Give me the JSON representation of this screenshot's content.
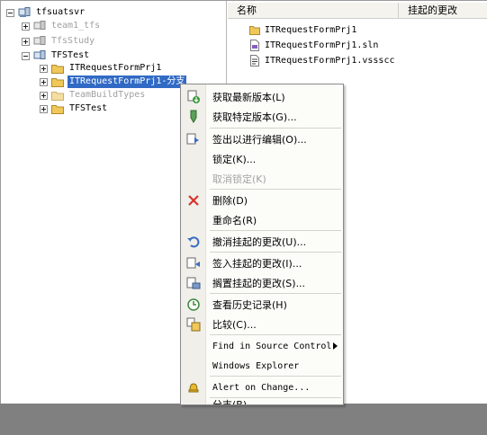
{
  "tree": {
    "items": [
      {
        "label": "tfsuatsvr"
      },
      {
        "label": "team1_tfs"
      },
      {
        "label": "TfsStudy"
      },
      {
        "label": "TFSTest"
      },
      {
        "label": "ITRequestFormPrj1"
      },
      {
        "label": "ITRequestFormPrj1-分支"
      },
      {
        "label": "TeamBuildTypes"
      },
      {
        "label": "TFSTest"
      }
    ]
  },
  "list": {
    "columns": {
      "name": "名称",
      "pending": "挂起的更改"
    },
    "rows": [
      {
        "name": "ITRequestFormPrj1"
      },
      {
        "name": "ITRequestFormPrj1.sln"
      },
      {
        "name": "ITRequestFormPrj1.vssscc"
      }
    ]
  },
  "menu": {
    "items": [
      {
        "label": "获取最新版本(L)",
        "icon": "get-latest-icon"
      },
      {
        "label": "获取特定版本(G)...",
        "icon": "get-specific-icon"
      },
      {
        "label": "签出以进行编辑(O)...",
        "icon": "checkout-icon"
      },
      {
        "label": "锁定(K)..."
      },
      {
        "label": "取消锁定(K)"
      },
      {
        "label": "删除(D)",
        "icon": "delete-icon"
      },
      {
        "label": "重命名(R)"
      },
      {
        "label": "撤消挂起的更改(U)...",
        "icon": "undo-icon"
      },
      {
        "label": "签入挂起的更改(I)...",
        "icon": "checkin-icon"
      },
      {
        "label": "搁置挂起的更改(S)...",
        "icon": "shelve-icon"
      },
      {
        "label": "查看历史记录(H)",
        "icon": "history-icon"
      },
      {
        "label": "比较(C)...",
        "icon": "compare-icon"
      },
      {
        "label": "Find in Source Control"
      },
      {
        "label": "Windows Explorer"
      },
      {
        "label": "Alert on Change...",
        "icon": "bell-icon"
      },
      {
        "label": "分支(B)..."
      }
    ]
  },
  "colors": {
    "selection": "#316ac5",
    "folder": "#f0c85a",
    "disabled_text": "#a3a3a3",
    "delete_red": "#d9332a"
  }
}
